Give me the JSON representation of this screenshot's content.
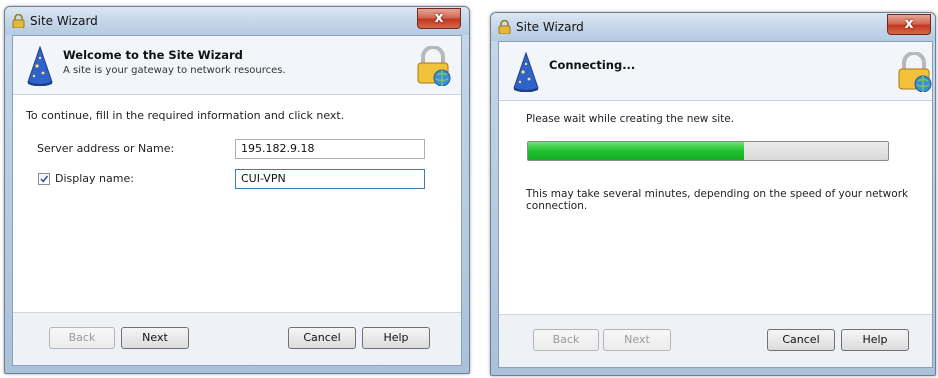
{
  "window1": {
    "title": "Site Wizard",
    "close_label": "x",
    "banner": {
      "title": "Welcome to the Site Wizard",
      "subtitle": "A site is your gateway to network resources.",
      "icon": "wizard-hat-icon",
      "right_icon": "lock-globe-icon"
    },
    "instruction": "To continue, fill in the required information and click next.",
    "server_label": "Server address or Name:",
    "server_value": "195.182.9.18",
    "display_name_checked": true,
    "display_name_label": "Display name:",
    "display_name_value": "CUI-VPN",
    "buttons": {
      "back": "Back",
      "next": "Next",
      "cancel": "Cancel",
      "help": "Help"
    }
  },
  "window2": {
    "title": "Site Wizard",
    "close_label": "x",
    "banner": {
      "title": "Connecting...",
      "icon": "wizard-hat-icon",
      "right_icon": "lock-globe-icon"
    },
    "status": "Please wait while creating the new site.",
    "progress": 0.6,
    "note": "This may take several minutes, depending on the speed of your network connection.",
    "buttons": {
      "back": "Back",
      "next": "Next",
      "cancel": "Cancel",
      "help": "Help"
    }
  },
  "colors": {
    "progress": "#20c030",
    "close": "#c2371f"
  }
}
